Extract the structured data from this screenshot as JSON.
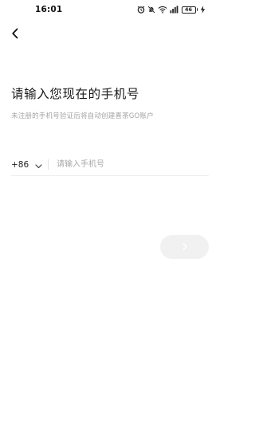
{
  "status_bar": {
    "time": "16:01",
    "icons": [
      "alarm-icon",
      "mute-icon",
      "wifi-icon",
      "signal-icon",
      "battery-icon",
      "charging-icon"
    ],
    "battery_level": "46"
  },
  "header": {
    "back_icon": "chevron-left-icon"
  },
  "main": {
    "title": "请输入您现在的手机号",
    "subtitle": "未注册的手机号验证后将自动创建喜茶GO账户"
  },
  "phone_form": {
    "country_code": "+86",
    "dropdown_icon": "chevron-down-icon",
    "input_value": "",
    "input_placeholder": "请输入手机号"
  },
  "next_button": {
    "icon": "chevron-right-icon",
    "enabled": false
  },
  "colors": {
    "background": "#ffffff",
    "title_text": "#1a1a1a",
    "subtitle_text": "#a5a5a5",
    "placeholder_text": "#a9a9a9",
    "divider": "#eeeeee",
    "next_button_disabled_bg": "#f1f1f1",
    "next_button_icon_disabled": "#ffffff"
  }
}
